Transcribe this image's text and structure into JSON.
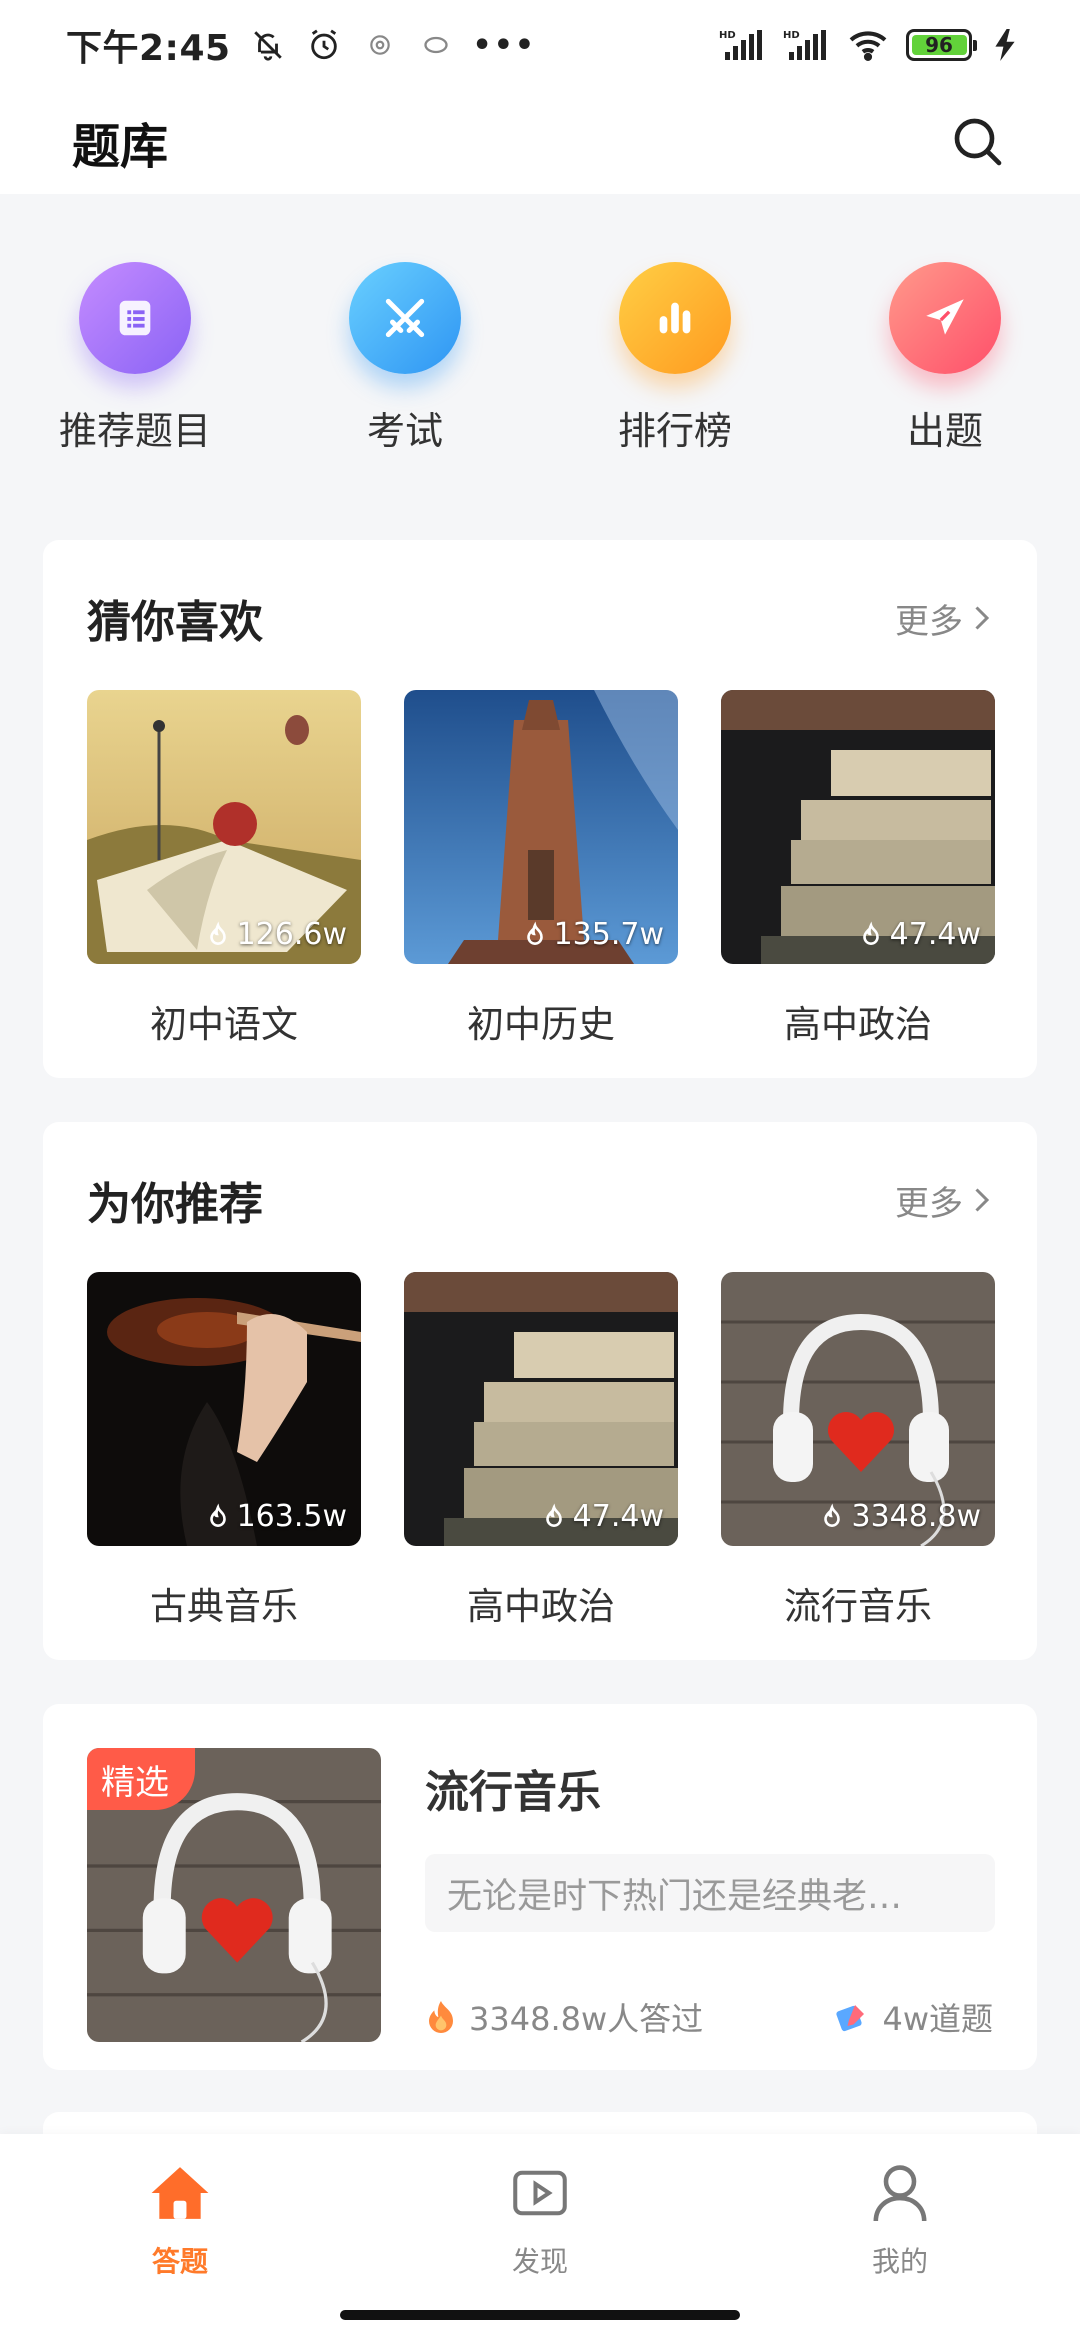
{
  "status_bar": {
    "time": "下午2:45",
    "battery": "96",
    "icons_left": [
      "bell-off-icon",
      "alarm-icon",
      "app-icon",
      "app-icon"
    ],
    "more": "•••",
    "signal_label": "HD"
  },
  "header": {
    "title": "题库",
    "search_icon": "search-icon"
  },
  "quick_actions": [
    {
      "label": "推荐题目",
      "icon": "list-icon",
      "color": "#8a63f5"
    },
    {
      "label": "考试",
      "icon": "swords-icon",
      "color": "#2e95f3"
    },
    {
      "label": "排行榜",
      "icon": "bar-chart-icon",
      "color": "#ff9a1f"
    },
    {
      "label": "出题",
      "icon": "paper-plane-icon",
      "color": "#ff4f6a"
    }
  ],
  "guess_section": {
    "title": "猜你喜欢",
    "more": "更多",
    "items": [
      {
        "label": "初中语文",
        "count": "126.6w"
      },
      {
        "label": "初中历史",
        "count": "135.7w"
      },
      {
        "label": "高中政治",
        "count": "47.4w"
      }
    ]
  },
  "recommend_section": {
    "title": "为你推荐",
    "more": "更多",
    "items": [
      {
        "label": "古典音乐",
        "count": "163.5w"
      },
      {
        "label": "高中政治",
        "count": "47.4w"
      },
      {
        "label": "流行音乐",
        "count": "3348.8w"
      }
    ]
  },
  "featured": {
    "badge": "精选",
    "title": "流行音乐",
    "description": "无论是时下热门还是经典老…",
    "answered": "3348.8w人答过",
    "questions": "4w道题"
  },
  "bottom_nav": [
    {
      "label": "答题",
      "icon": "home-icon",
      "active": true
    },
    {
      "label": "发现",
      "icon": "play-icon",
      "active": false
    },
    {
      "label": "我的",
      "icon": "user-icon",
      "active": false
    }
  ],
  "colors": {
    "accent": "#ff7a2a",
    "badge": "#ff5b48"
  }
}
